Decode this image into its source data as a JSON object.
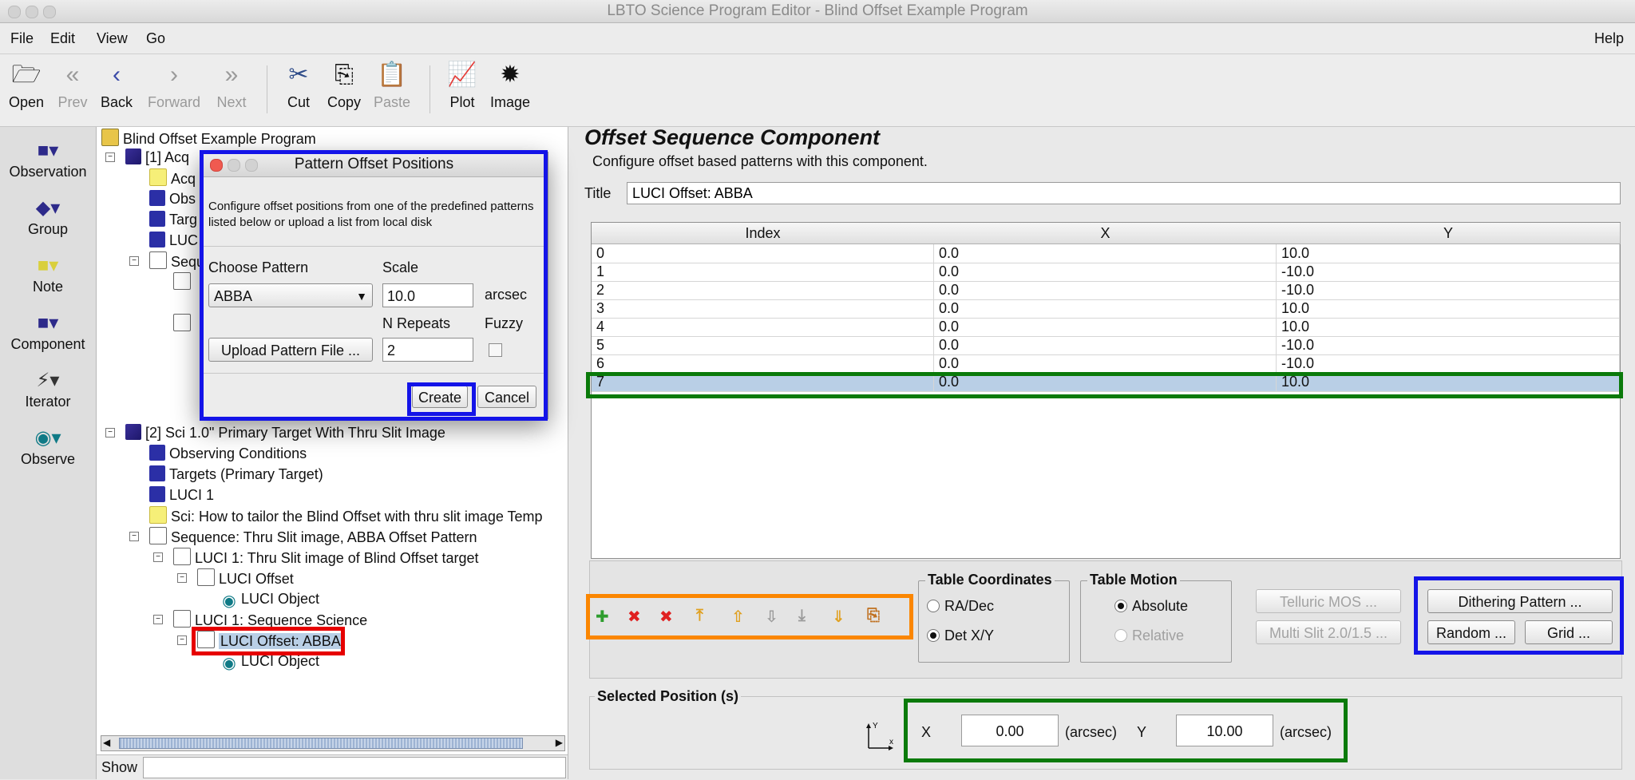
{
  "window": {
    "title": "LBTO Science Program Editor - Blind Offset Example Program"
  },
  "menu": {
    "file": "File",
    "edit": "Edit",
    "view": "View",
    "go": "Go",
    "help": "Help"
  },
  "toolbar": {
    "open": "Open",
    "prev": "Prev",
    "back": "Back",
    "forward": "Forward",
    "next": "Next",
    "cut": "Cut",
    "copy": "Copy",
    "paste": "Paste",
    "plot": "Plot",
    "image": "Image"
  },
  "palette": {
    "observation": "Observation",
    "group": "Group",
    "note": "Note",
    "component": "Component",
    "iterator": "Iterator",
    "observe": "Observe"
  },
  "tree": {
    "root": "Blind Offset Example Program",
    "acq": "[1] Acq",
    "acq_children": [
      "Acq",
      "Obs",
      "Targ",
      "LUC",
      "Sequ"
    ],
    "sci": "[2] Sci 1.0\" Primary Target With Thru Slit Image",
    "sci_children": {
      "cond": "Observing Conditions",
      "targets": "Targets (Primary Target)",
      "luci": "LUCI 1",
      "note": "Sci: How to tailor the Blind Offset with thru slit image Temp",
      "seq": "Sequence: Thru Slit image, ABBA Offset Pattern",
      "thru": "LUCI 1: Thru Slit image of Blind Offset target",
      "offset1": "LUCI Offset",
      "object1": "LUCI Object",
      "seqsci": "LUCI 1: Sequence Science",
      "offset2": "LUCI Offset: ABBA",
      "object2": "LUCI Object"
    },
    "show_label": "Show"
  },
  "dialog": {
    "title": "Pattern Offset Positions",
    "description": "Configure offset positions from one of the predefined patterns listed below or upload a list from local disk",
    "choose_pattern_label": "Choose Pattern",
    "pattern_value": "ABBA",
    "scale_label": "Scale",
    "scale_value": "10.0",
    "scale_unit": "arcsec",
    "repeats_label": "N Repeats",
    "repeats_value": "2",
    "fuzzy_label": "Fuzzy",
    "upload_label": "Upload Pattern File ...",
    "create_label": "Create",
    "cancel_label": "Cancel"
  },
  "editor": {
    "component_title": "Offset Sequence Component",
    "description": "Configure offset based patterns with this component.",
    "title_label": "Title",
    "title_value": "LUCI Offset: ABBA",
    "table": {
      "headers": [
        "Index",
        "X",
        "Y"
      ],
      "rows": [
        [
          "0",
          "0.0",
          "10.0"
        ],
        [
          "1",
          "0.0",
          "-10.0"
        ],
        [
          "2",
          "0.0",
          "-10.0"
        ],
        [
          "3",
          "0.0",
          "10.0"
        ],
        [
          "4",
          "0.0",
          "10.0"
        ],
        [
          "5",
          "0.0",
          "-10.0"
        ],
        [
          "6",
          "0.0",
          "-10.0"
        ],
        [
          "7",
          "0.0",
          "10.0"
        ]
      ],
      "selected_row": 7
    },
    "table_coordinates": {
      "legend": "Table Coordinates",
      "radec": "RA/Dec",
      "detxy": "Det X/Y",
      "selected": "Det X/Y"
    },
    "table_motion": {
      "legend": "Table Motion",
      "absolute": "Absolute",
      "relative": "Relative",
      "selected": "Absolute"
    },
    "buttons": {
      "telluric": "Telluric MOS ...",
      "multislit": "Multi Slit 2.0/1.5 ...",
      "dithering": "Dithering Pattern ...",
      "random": "Random ...",
      "grid": "Grid ..."
    },
    "selected_position": {
      "legend": "Selected Position (s)",
      "x_label": "X",
      "x_value": "0.00",
      "y_label": "Y",
      "y_value": "10.00",
      "unit": "(arcsec)",
      "axis_x": "x",
      "axis_y": "Y"
    }
  },
  "colors": {
    "highlight_blue": "#1414e8",
    "highlight_green": "#0a7a0a",
    "highlight_orange": "#fb8600",
    "highlight_red": "#e60000",
    "selection": "#b9cfe6"
  }
}
